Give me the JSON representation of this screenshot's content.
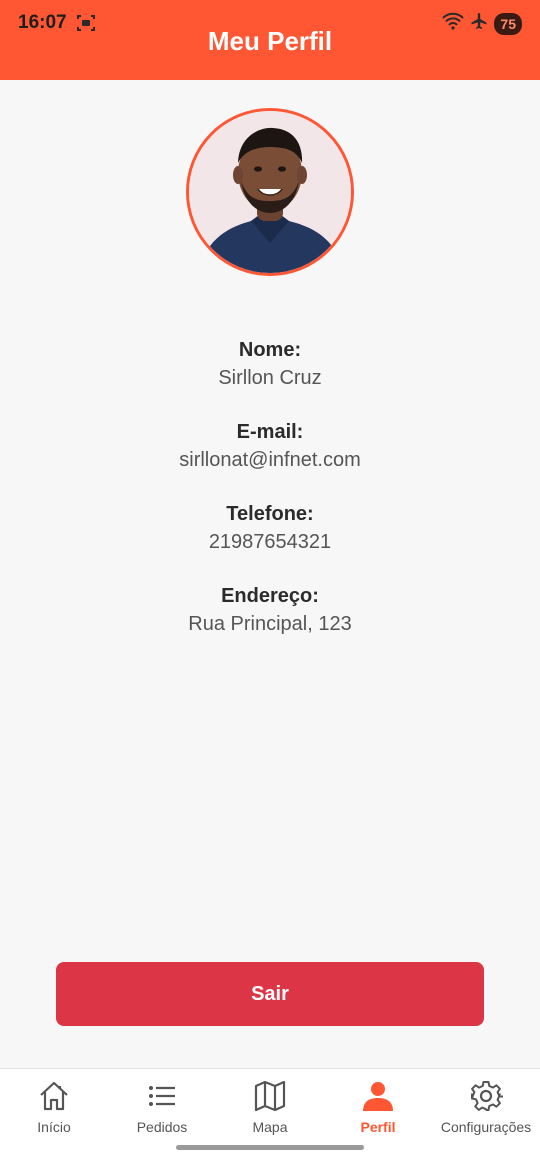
{
  "status_bar": {
    "time": "16:07",
    "battery": "75",
    "icons": [
      "screen-record-icon",
      "wifi-icon",
      "airplane-icon",
      "battery-icon"
    ]
  },
  "header": {
    "title": "Meu Perfil",
    "color": "#ff5733"
  },
  "profile": {
    "avatar_icon": "profile-photo",
    "fields": [
      {
        "label": "Nome:",
        "value": "Sirllon Cruz"
      },
      {
        "label": "E-mail:",
        "value": "sirllonat@infnet.com"
      },
      {
        "label": "Telefone:",
        "value": "21987654321"
      },
      {
        "label": "Endereço:",
        "value": "Rua Principal, 123"
      }
    ]
  },
  "logout_button": {
    "label": "Sair",
    "color": "#dc3545"
  },
  "tab_bar": {
    "active_tab": "Perfil",
    "active_color": "#ff5733",
    "tabs": [
      {
        "label": "Início",
        "icon": "home-icon"
      },
      {
        "label": "Pedidos",
        "icon": "list-icon"
      },
      {
        "label": "Mapa",
        "icon": "map-icon"
      },
      {
        "label": "Perfil",
        "icon": "person-icon"
      },
      {
        "label": "Configurações",
        "icon": "gear-icon"
      }
    ]
  }
}
